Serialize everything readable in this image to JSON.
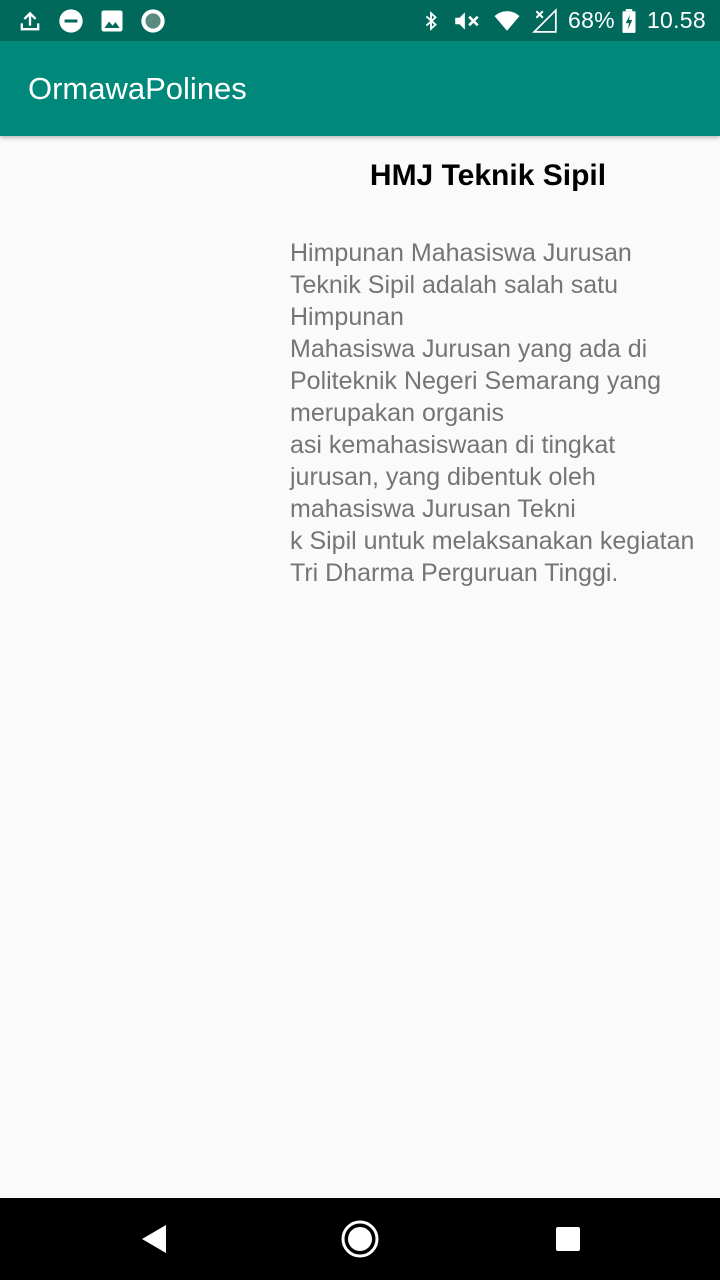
{
  "status_bar": {
    "left_icons": [
      "upload-icon",
      "do-not-disturb-icon",
      "image-icon",
      "circle-notification-icon"
    ],
    "right_icons": [
      "bluetooth-icon",
      "volume-muted-icon",
      "wifi-icon",
      "no-signal-icon",
      "battery-charging-icon"
    ],
    "battery_percent": "68%",
    "time": "10.58"
  },
  "app_bar": {
    "title": "OrmawaPolines"
  },
  "organization": {
    "title": "HMJ Teknik Sipil",
    "description": "Himpunan Mahasiswa Jurusan Teknik Sipil adalah salah satu Himpunan\nMahasiswa Jurusan yang ada di Politeknik Negeri Semarang yang merupakan organis\nasi kemahasiswaan di tingkat jurusan, yang dibentuk oleh mahasiswa Jurusan Tekni\nk Sipil untuk melaksanakan kegiatan Tri Dharma Perguruan Tinggi."
  },
  "navigation_bar": {
    "buttons": [
      "back-icon",
      "home-icon",
      "recent-apps-icon"
    ]
  },
  "colors": {
    "status_bar": "#00695c",
    "app_bar": "#00897b",
    "background": "#fafafa",
    "description_text": "#757575"
  }
}
